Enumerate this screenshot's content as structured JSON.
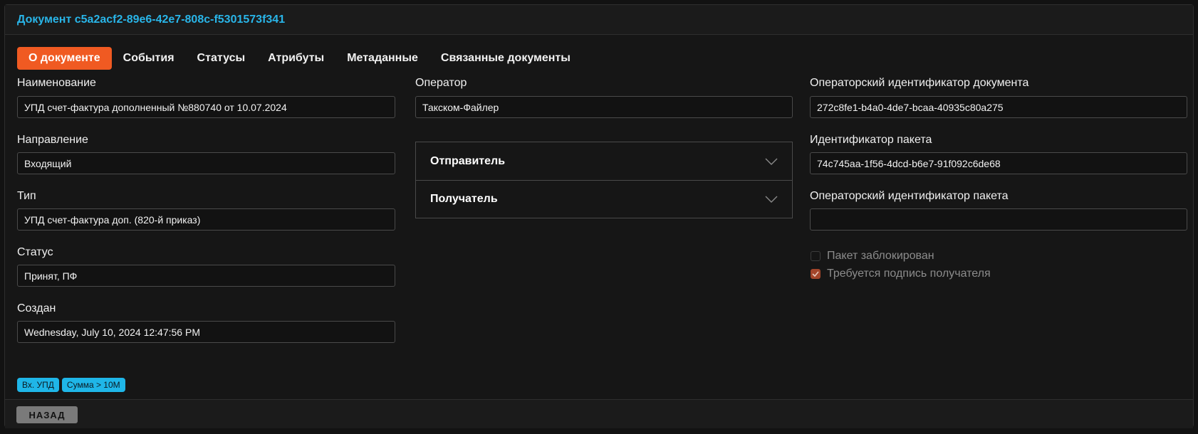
{
  "document": {
    "title": "Документ c5a2acf2-89e6-42e7-808c-f5301573f341"
  },
  "tabs": [
    {
      "label": "О документе",
      "active": true
    },
    {
      "label": "События"
    },
    {
      "label": "Статусы"
    },
    {
      "label": "Атрибуты"
    },
    {
      "label": "Метаданные"
    },
    {
      "label": "Связанные документы"
    }
  ],
  "left": {
    "name": {
      "label": "Наименование",
      "value": "УПД счет-фактура дополненный №880740 от 10.07.2024"
    },
    "direction": {
      "label": "Направление",
      "value": "Входящий"
    },
    "type": {
      "label": "Тип",
      "value": "УПД счет-фактура доп. (820-й приказ)"
    },
    "status": {
      "label": "Статус",
      "value": "Принят, ПФ"
    },
    "created": {
      "label": "Создан",
      "value": "Wednesday, July 10, 2024 12:47:56 PM"
    }
  },
  "middle": {
    "operator": {
      "label": "Оператор",
      "value": "Такском-Файлер"
    },
    "sender_label": "Отправитель",
    "recipient_label": "Получатель"
  },
  "right": {
    "operator_doc_id": {
      "label": "Операторский идентификатор документа",
      "value": "272c8fe1-b4a0-4de7-bcaa-40935c80a275"
    },
    "package_id": {
      "label": "Идентификатор пакета",
      "value": "74c745aa-1f56-4dcd-b6e7-91f092c6de68"
    },
    "operator_package_id": {
      "label": "Операторский идентификатор пакета",
      "value": ""
    },
    "package_locked": {
      "label": "Пакет заблокирован",
      "checked": false
    },
    "recipient_signature": {
      "label": "Требуется подпись получателя",
      "checked": true
    }
  },
  "badges": [
    "Вх. УПД",
    "Сумма > 10M"
  ],
  "footer": {
    "back_label": "НАЗАД"
  },
  "colors": {
    "accent": "#f05a22",
    "title": "#29b5e8",
    "badge": "#1fb6e8",
    "checkbox_checked": "#a3452a"
  }
}
